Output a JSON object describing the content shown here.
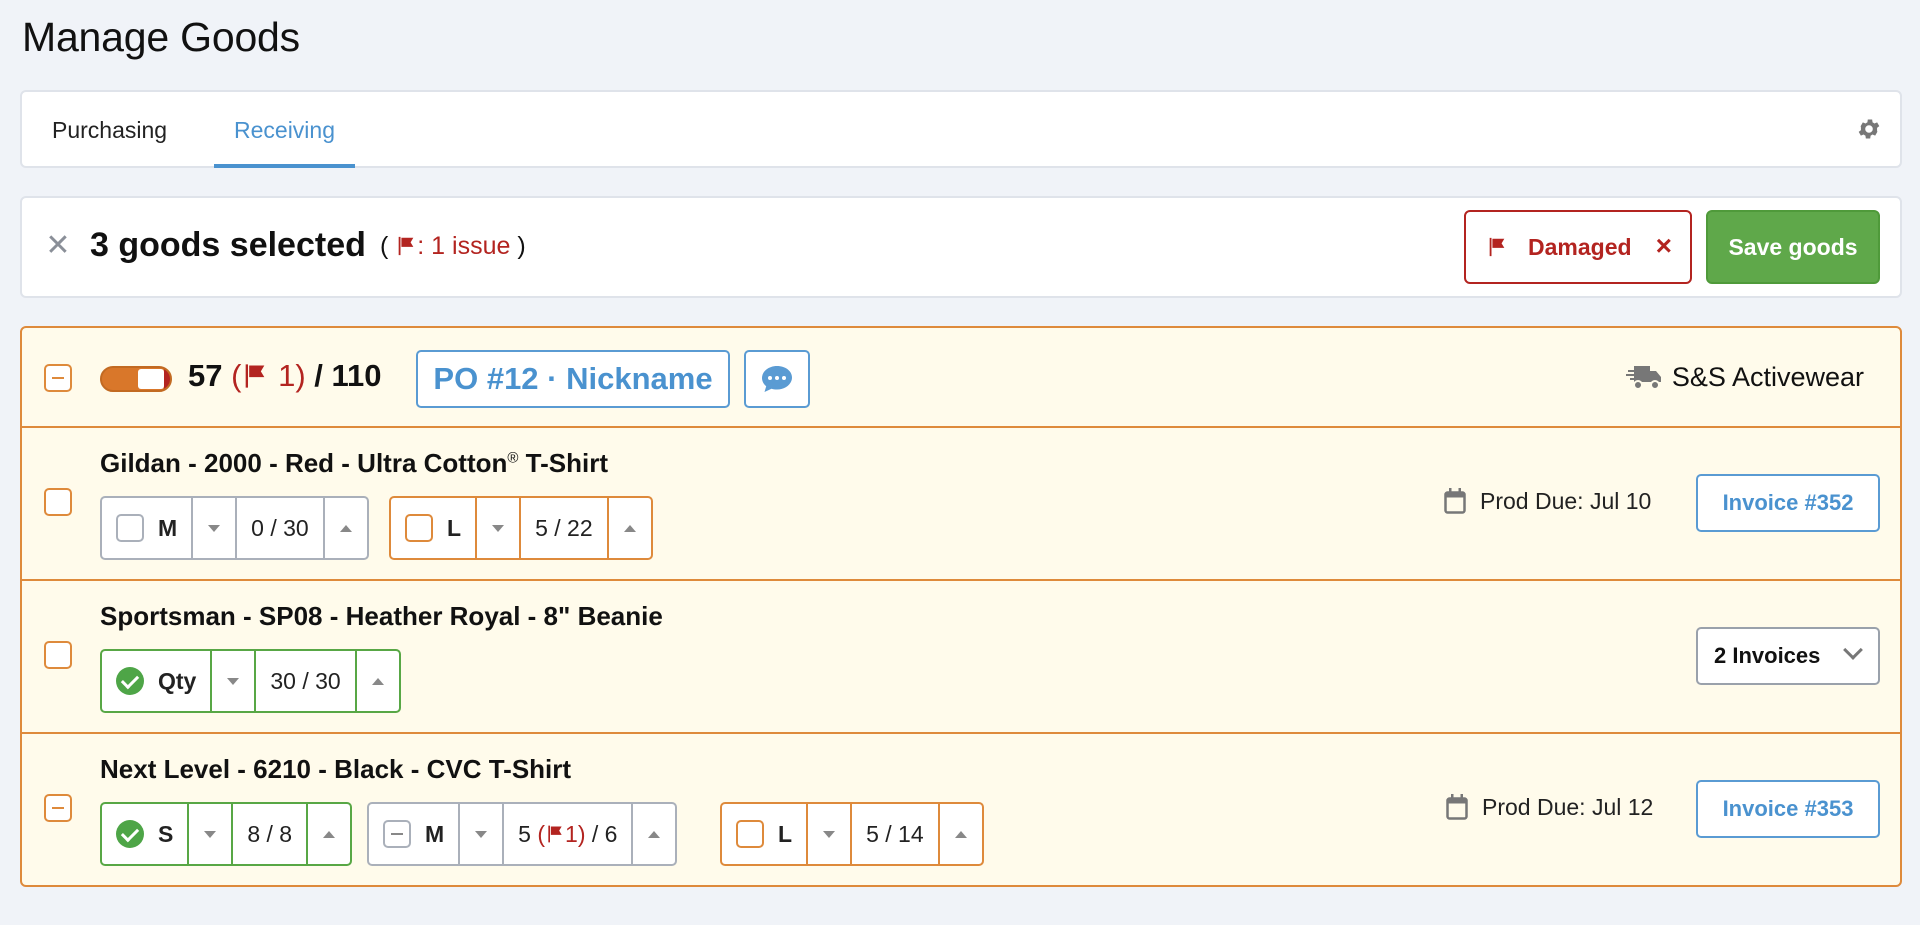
{
  "page": {
    "title": "Manage Goods"
  },
  "tabs": [
    {
      "label": "Purchasing",
      "active": false
    },
    {
      "label": "Receiving",
      "active": true
    }
  ],
  "icons": {
    "settings": "gear-icon",
    "close": "close-icon",
    "flag": "flag-icon",
    "chat": "chat-bubble-icon",
    "truck": "truck-icon",
    "calendar": "calendar-icon",
    "check": "check-circle-icon",
    "chevron": "chevron-down-icon"
  },
  "colors": {
    "accent": "#4a92cf",
    "warning": "#de8a3b",
    "danger": "#b32420",
    "success": "#5fa84a",
    "panel_bg": "#fffbeb"
  },
  "selection": {
    "text": "3 goods selected",
    "issue_open": "(",
    "issue_text": ": 1 issue",
    "issue_close": ")",
    "damaged_label": "Damaged",
    "save_label": "Save goods"
  },
  "po": {
    "received": "57",
    "issues_open": "(",
    "issues": "1",
    "issues_close": ")",
    "sep": "/",
    "total": "110",
    "po_label": "PO #12 · Nickname",
    "vendor": "S&S Activewear",
    "items": [
      {
        "title": "Gildan - 2000 - Red - Ultra Cotton",
        "title_mark": "®",
        "title_suffix": " T-Shirt",
        "sizes": [
          {
            "label": "M",
            "value": "0 / 30"
          },
          {
            "label": "L",
            "value": "5 / 22"
          }
        ],
        "due": "Prod Due: Jul 10",
        "invoice": "Invoice #352"
      },
      {
        "title": "Sportsman - SP08 - Heather Royal - 8\" Beanie",
        "sizes": [
          {
            "label": "Qty",
            "value": "30 / 30"
          }
        ],
        "invoice": "2 Invoices"
      },
      {
        "title": "Next Level - 6210 - Black - CVC T-Shirt",
        "sizes": [
          {
            "label": "S",
            "value": "8 / 8"
          },
          {
            "label": "M",
            "value_pre": "5",
            "value_open": "(",
            "value_issue": "1",
            "value_close": ")",
            "value_post": "/ 6"
          },
          {
            "label": "L",
            "value": "5 / 14"
          }
        ],
        "due": "Prod Due: Jul 12",
        "invoice": "Invoice #353"
      }
    ]
  }
}
